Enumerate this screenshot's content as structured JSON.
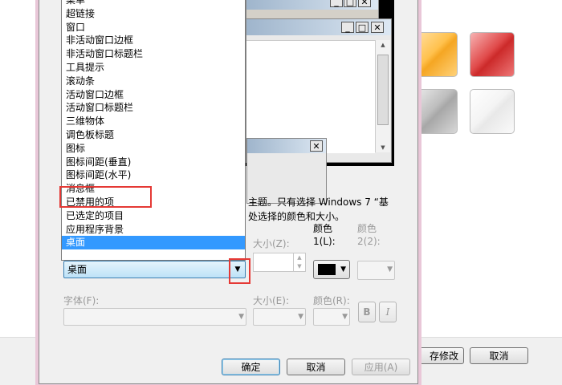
{
  "background": {
    "save_button": "存修改",
    "cancel_button": "取消"
  },
  "dialog": {
    "list_items": [
      "菜单",
      "超链接",
      "窗口",
      "非活动窗口边框",
      "非活动窗口标题栏",
      "工具提示",
      "滚动条",
      "活动窗口边框",
      "活动窗口标题栏",
      "三维物体",
      "调色板标题",
      "图标",
      "图标间距(垂直)",
      "图标间距(水平)",
      "消息框",
      "已禁用的项",
      "已选定的项目",
      "应用程序背景",
      "桌面"
    ],
    "selected_list_item": "桌面",
    "item_combo_value": "桌面",
    "description_line1": "主题。只有选择 Windows 7 “基",
    "description_line2": "处选择的颜色和大小。",
    "labels": {
      "size": "大小(Z):",
      "color1": "颜色\n1(L):",
      "color2": "颜色\n2(2):",
      "font": "字体(F):",
      "font_size": "大小(E):",
      "font_color": "颜色(R):"
    },
    "bold_label": "B",
    "italic_label": "I",
    "buttons": {
      "ok": "确定",
      "cancel": "取消",
      "apply": "应用(A)"
    },
    "colors": {
      "color1": "#000000",
      "selection": "#3399ff",
      "highlight_box": "#e53935"
    }
  }
}
